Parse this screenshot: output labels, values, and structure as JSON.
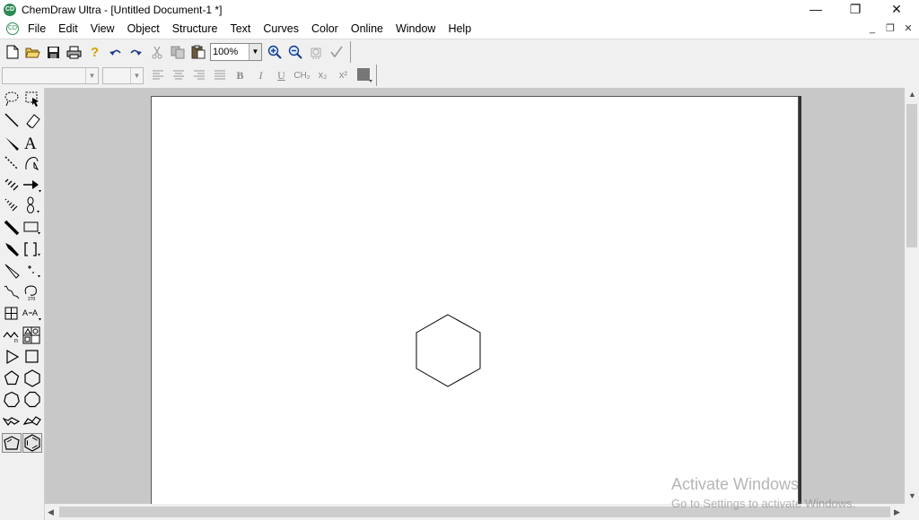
{
  "window": {
    "app_icon_text": "CD",
    "title": "ChemDraw Ultra - [Untitled Document-1 *]",
    "controls": {
      "minimize": "—",
      "maximize": "❐",
      "close": "✕"
    }
  },
  "menubar": {
    "doc_icon_text": "CD",
    "items": [
      "File",
      "Edit",
      "View",
      "Object",
      "Structure",
      "Text",
      "Curves",
      "Color",
      "Online",
      "Window",
      "Help"
    ],
    "mdi_controls": {
      "minimize": "_",
      "restore": "❐",
      "close": "✕"
    }
  },
  "toolbar_main": {
    "icons": [
      "new-document",
      "open-folder",
      "save",
      "print",
      "help",
      "undo",
      "redo",
      "cut",
      "copy",
      "paste"
    ],
    "zoom": {
      "value": "100%"
    },
    "icons_after": [
      "zoom-in",
      "zoom-out",
      "clean-structure",
      "check-structure"
    ]
  },
  "toolbar_format": {
    "font_select": "",
    "size_select": "",
    "buttons": {
      "bold": "B",
      "italic": "I",
      "underline": "U",
      "formula": "CH₂",
      "subscript": "x₂",
      "superscript": "x²"
    }
  },
  "palette": {
    "tools": [
      [
        "lasso",
        "marquee"
      ],
      [
        "solid-bond",
        "eraser"
      ],
      [
        "wedge-bond",
        "text"
      ],
      [
        "dashed-bond",
        "pen"
      ],
      [
        "hashed-bond",
        "arrow"
      ],
      [
        "hashed-wedge-bond",
        "orbital"
      ],
      [
        "bold-bond",
        "drawing-elements"
      ],
      [
        "bold-wedge-bond",
        "brackets"
      ],
      [
        "hollow-wedge-bond",
        "chemical-symbols"
      ],
      [
        "wavy-bond",
        "query"
      ],
      [
        "table",
        "mass-fragmentation"
      ],
      [
        "acyclic-chain",
        "templates"
      ],
      [
        "cyclopropane",
        "cyclobutane"
      ],
      [
        "cyclopentane",
        "cyclohexane"
      ],
      [
        "cycloheptane",
        "cyclooctane"
      ],
      [
        "cyclohexane-chair-1",
        "cyclohexane-chair-2"
      ],
      [
        "cyclopentadiene",
        "benzene"
      ]
    ],
    "labels": {
      "text_tool": "A"
    }
  },
  "canvas": {
    "drawn_structure": "cyclohexane-ring"
  },
  "watermark": {
    "title": "Activate Windows",
    "subtitle": "Go to Settings to activate Windows."
  }
}
